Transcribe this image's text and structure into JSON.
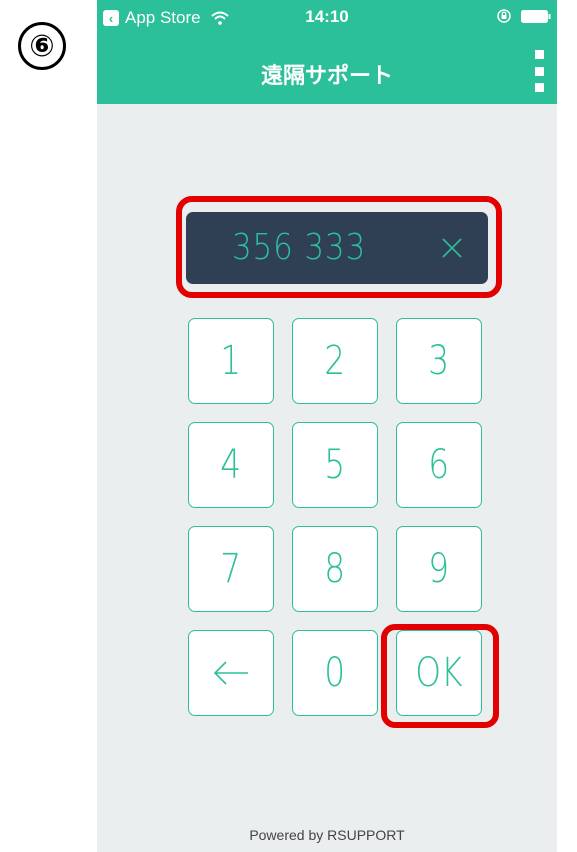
{
  "step_marker": "⑥",
  "status_bar": {
    "back_app_label": "App Store",
    "time": "14:10"
  },
  "nav": {
    "title": "遠隔サポート"
  },
  "display": {
    "value": "356 333"
  },
  "keypad": {
    "keys": [
      "1",
      "2",
      "3",
      "4",
      "5",
      "6",
      "7",
      "8",
      "9",
      "0"
    ],
    "ok_label": "OK"
  },
  "footer": {
    "powered_by": "Powered by RSUPPORT"
  },
  "colors": {
    "accent": "#2bbf9a",
    "display_bg": "#2f4055",
    "background": "#eaeeee",
    "highlight": "#e30000"
  },
  "icons": {
    "back_app": "chevron-left-icon",
    "wifi": "wifi-icon",
    "orientation_lock": "orientation-lock-icon",
    "battery": "battery-icon",
    "more": "more-vertical-icon",
    "clear": "close-icon",
    "backspace": "arrow-left-icon"
  }
}
